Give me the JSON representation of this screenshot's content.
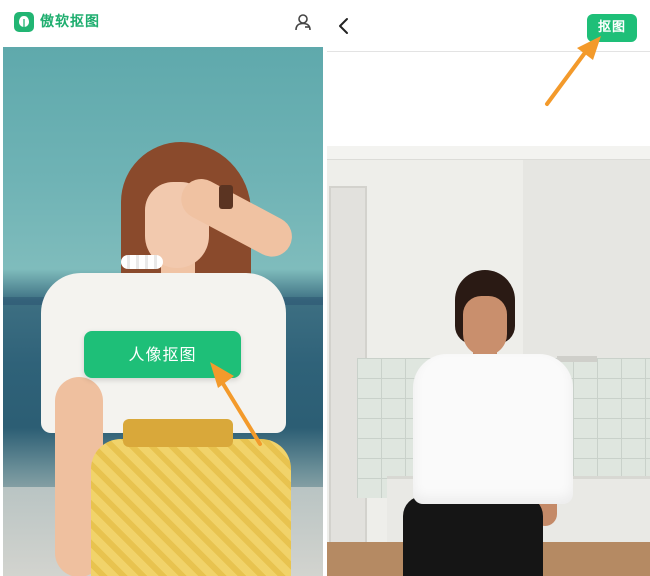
{
  "left_screen": {
    "app_name": "傲软抠图",
    "icons": {
      "logo": "leaf-logo-icon",
      "user": "user-icon"
    },
    "photo_subject": "woman-in-white-top-and-yellow-skirt",
    "portrait_button_label": "人像抠图"
  },
  "right_screen": {
    "icons": {
      "back": "chevron-left-icon"
    },
    "cutout_button_label": "抠图",
    "photo_subject": "woman-in-white-tshirt-in-tiled-room"
  },
  "colors": {
    "brand_green": "#1ebf78",
    "annotation_arrow": "#f39a2b"
  }
}
